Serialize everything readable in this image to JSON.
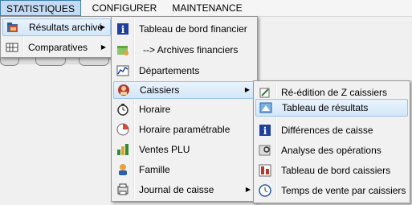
{
  "menubar": {
    "items": [
      {
        "label": "STATISTIQUES",
        "active": true
      },
      {
        "label": "CONFIGURER",
        "active": false
      },
      {
        "label": "MAINTENANCE",
        "active": false
      }
    ]
  },
  "menu_statistiques": {
    "items": [
      {
        "label": "Résultats archivé",
        "icon": "archive-folder-icon",
        "submenu": true,
        "highlighted": true
      },
      {
        "label": "Comparatives",
        "icon": "compare-grid-icon",
        "submenu": true,
        "highlighted": false
      }
    ]
  },
  "menu_resultats": {
    "items": [
      {
        "label": "Tableau de bord financier",
        "icon": "info-icon"
      },
      {
        "label": "--> Archives financiers",
        "icon": "archive-box-icon"
      },
      {
        "label": "Départements",
        "icon": "chart-icon"
      },
      {
        "label": "Caissiers",
        "icon": "cashier-icon",
        "submenu": true,
        "highlighted": true
      },
      {
        "label": "Horaire",
        "icon": "clock-icon"
      },
      {
        "label": "Horaire paramétrable",
        "icon": "pie-chart-icon"
      },
      {
        "label": "Ventes PLU",
        "icon": "bar-chart-icon"
      },
      {
        "label": "Famille",
        "icon": "person-icon"
      },
      {
        "label": "Journal de caisse",
        "icon": "journal-icon",
        "submenu": true
      }
    ]
  },
  "menu_caissiers": {
    "items": [
      {
        "label": "Ré-édition de Z caissiers",
        "icon": "reprint-icon"
      },
      {
        "label": "Tableau de résultats",
        "icon": "results-icon",
        "highlighted": true
      },
      {
        "label": "Différences de caisse",
        "icon": "info-icon"
      },
      {
        "label": "Analyse des opérations",
        "icon": "analysis-icon"
      },
      {
        "label": "Tableau de bord caissiers",
        "icon": "dashboard-icon"
      },
      {
        "label": "Temps de vente par caissiers",
        "icon": "clock-icon"
      }
    ]
  },
  "colors": {
    "highlight": "#d3e6f8",
    "highlight_border": "#9cc3e9",
    "menubar_active": "#c5dbf4"
  }
}
